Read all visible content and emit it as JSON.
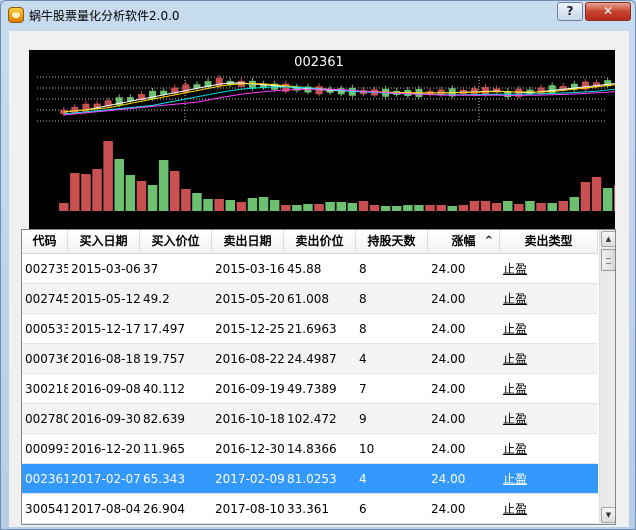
{
  "window": {
    "title": "蜗牛股票量化分析软件2.0.0",
    "help_label": "?",
    "close_label": "✕"
  },
  "chart": {
    "stock_code": "002361",
    "colors": {
      "up": "#c85050",
      "down": "#6cc070",
      "ma5": "#ffffff",
      "ma10": "#ffd800",
      "ma20": "#ff40ff",
      "ma30": "#00e0e0",
      "grid": "#c0c0c0",
      "background": "#000000"
    }
  },
  "chart_data": {
    "type": "bar",
    "title": "002361",
    "volume_bar_colors": [
      "up",
      "up",
      "up",
      "up",
      "up",
      "down",
      "down",
      "up",
      "down",
      "down",
      "up",
      "up",
      "down",
      "down",
      "up",
      "down",
      "up",
      "down",
      "down",
      "down",
      "up",
      "down",
      "down",
      "up",
      "down",
      "down",
      "down",
      "up",
      "up",
      "down",
      "down",
      "down",
      "down",
      "up",
      "up",
      "down",
      "up",
      "up",
      "up",
      "up",
      "down",
      "up",
      "down",
      "up",
      "down",
      "up",
      "down",
      "up",
      "up",
      "down",
      "up"
    ],
    "volume_values": [
      8,
      38,
      37,
      42,
      70,
      52,
      36,
      30,
      26,
      51,
      40,
      22,
      18,
      12,
      12,
      11,
      9,
      13,
      14,
      11,
      6,
      6,
      7,
      7,
      9,
      9,
      8,
      10,
      6,
      5,
      5,
      6,
      6,
      6,
      6,
      5,
      6,
      10,
      10,
      8,
      10,
      7,
      10,
      8,
      8,
      10,
      14,
      29,
      34,
      23,
      26
    ]
  },
  "table": {
    "columns": [
      "代码",
      "买入日期",
      "买入价位",
      "卖出日期",
      "卖出价位",
      "持股天数",
      "涨幅",
      "卖出类型"
    ],
    "sort_indicator": "^",
    "rows": [
      [
        "002735",
        "2015-03-06",
        "37",
        "2015-03-16",
        "45.88",
        "8",
        "24.00",
        "止盈"
      ],
      [
        "002745",
        "2015-05-12",
        "49.2",
        "2015-05-20",
        "61.008",
        "8",
        "24.00",
        "止盈"
      ],
      [
        "000533",
        "2015-12-17",
        "17.497",
        "2015-12-25",
        "21.6963",
        "8",
        "24.00",
        "止盈"
      ],
      [
        "000736",
        "2016-08-18",
        "19.757",
        "2016-08-22",
        "24.4987",
        "4",
        "24.00",
        "止盈"
      ],
      [
        "300218",
        "2016-09-08",
        "40.112",
        "2016-09-19",
        "49.7389",
        "7",
        "24.00",
        "止盈"
      ],
      [
        "002780",
        "2016-09-30",
        "82.639",
        "2016-10-18",
        "102.472",
        "9",
        "24.00",
        "止盈"
      ],
      [
        "000993",
        "2016-12-20",
        "11.965",
        "2016-12-30",
        "14.8366",
        "10",
        "24.00",
        "止盈"
      ],
      [
        "002361",
        "2017-02-07",
        "65.343",
        "2017-02-09",
        "81.0253",
        "4",
        "24.00",
        "止盈"
      ],
      [
        "300541",
        "2017-08-04",
        "26.904",
        "2017-08-10",
        "33.361",
        "6",
        "24.00",
        "止盈"
      ]
    ],
    "selected_row_index": 7
  }
}
